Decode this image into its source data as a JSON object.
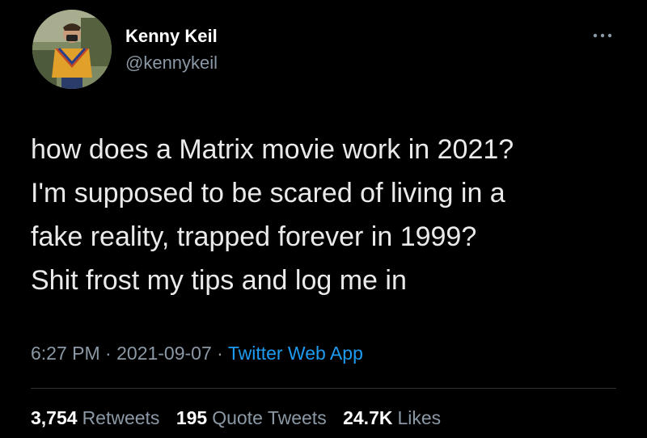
{
  "author": {
    "display_name": "Kenny Keil",
    "handle": "@kennykeil"
  },
  "tweet": {
    "lines": [
      "how does a Matrix movie work in 2021?",
      "I'm supposed to be scared of living in a",
      "fake reality, trapped forever in 1999?",
      "Shit frost my tips and log me in"
    ]
  },
  "meta": {
    "time": "6:27 PM",
    "separator": "·",
    "date": "2021-09-07",
    "source": "Twitter Web App"
  },
  "stats": {
    "retweets_count": "3,754",
    "retweets_label": "Retweets",
    "quotes_count": "195",
    "quotes_label": "Quote Tweets",
    "likes_count": "24.7K",
    "likes_label": "Likes"
  },
  "icons": {
    "more": "more-horizontal-icon"
  },
  "colors": {
    "background": "#000000",
    "secondary_text": "#8b98a5",
    "link": "#1d9bf0",
    "divider": "#2f3336"
  }
}
